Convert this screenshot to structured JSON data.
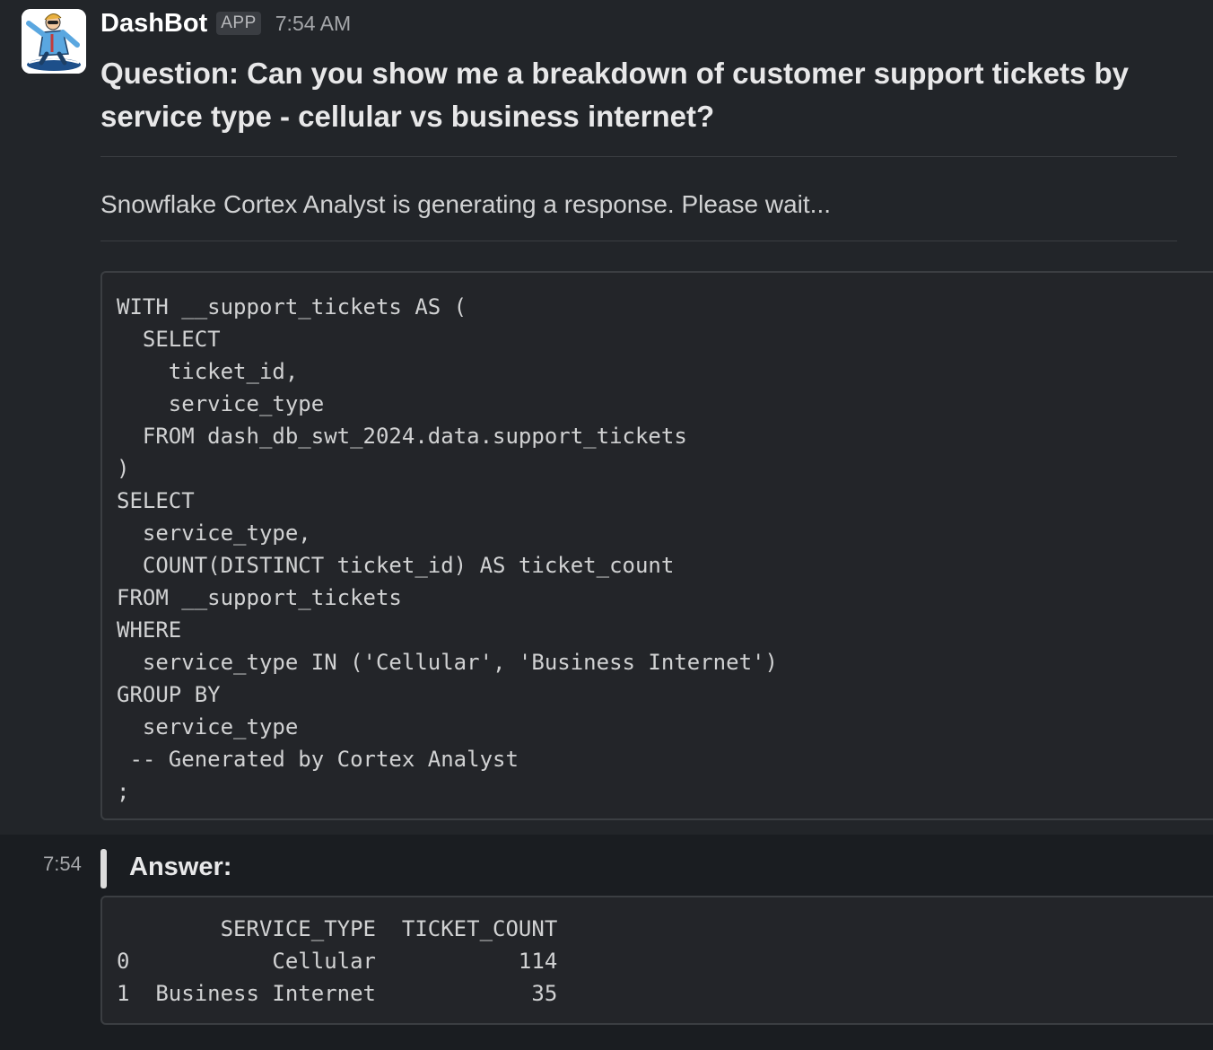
{
  "message": {
    "sender": "DashBot",
    "badge": "APP",
    "time": "7:54 AM",
    "question": "Question: Can you show me a breakdown of customer support tickets by service type - cellular vs business internet?",
    "status": "Snowflake Cortex Analyst is generating a response. Please wait...",
    "sql": "WITH __support_tickets AS (\n  SELECT\n    ticket_id,\n    service_type\n  FROM dash_db_swt_2024.data.support_tickets\n)\nSELECT\n  service_type,\n  COUNT(DISTINCT ticket_id) AS ticket_count\nFROM __support_tickets\nWHERE\n  service_type IN ('Cellular', 'Business Internet')\nGROUP BY\n  service_type\n -- Generated by Cortex Analyst\n;"
  },
  "followup": {
    "time": "7:54",
    "answer_label": "Answer:",
    "result": "        SERVICE_TYPE  TICKET_COUNT\n0           Cellular           114\n1  Business Internet            35"
  },
  "icons": {
    "avatar": "dashbot-mascot-avatar"
  }
}
